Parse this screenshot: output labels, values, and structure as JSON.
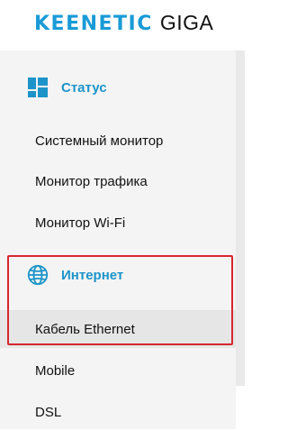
{
  "header": {
    "brand": "KEENETIC",
    "model": "GIGA"
  },
  "sidebar": {
    "sections": [
      {
        "label": "Статус",
        "icon": "dashboard-icon",
        "items": [
          {
            "label": "Системный монитор"
          },
          {
            "label": "Монитор трафика"
          },
          {
            "label": "Монитор Wi-Fi"
          }
        ]
      },
      {
        "label": "Интернет",
        "icon": "globe-icon",
        "items": [
          {
            "label": "Кабель Ethernet",
            "active": true
          },
          {
            "label": "Mobile"
          },
          {
            "label": "DSL"
          }
        ]
      }
    ]
  },
  "colors": {
    "accent": "#1c94c9",
    "highlight": "#d6262f"
  }
}
